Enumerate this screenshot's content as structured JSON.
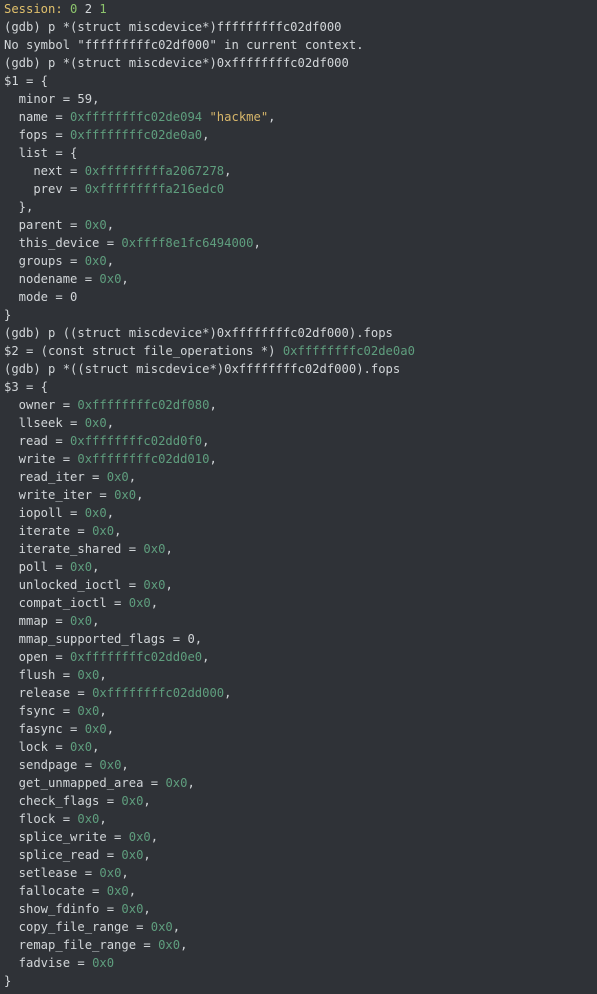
{
  "session_line": {
    "label": "Session:",
    "vals": [
      "0",
      "2",
      "1"
    ]
  },
  "lines": [
    {
      "k": "plain",
      "text": "(gdb) p *(struct miscdevice*)fffffffffc02df000"
    },
    {
      "k": "plain",
      "text": "No symbol \"fffffffffc02df000\" in current context."
    },
    {
      "k": "plain",
      "text": "(gdb) p *(struct miscdevice*)0xffffffffc02df000"
    },
    {
      "k": "plain",
      "text": "$1 = {"
    },
    {
      "k": "kv",
      "indent": "  ",
      "key": "minor",
      "sep": " = ",
      "val": "59",
      "cls": "num",
      "tail": ","
    },
    {
      "k": "kvq",
      "indent": "  ",
      "key": "name",
      "sep": " = ",
      "addr": "0xffffffffc02de094",
      "str": "\"hackme\"",
      "tail": ","
    },
    {
      "k": "kv",
      "indent": "  ",
      "key": "fops",
      "sep": " = ",
      "val": "0xffffffffc02de0a0",
      "cls": "addr",
      "tail": ","
    },
    {
      "k": "plain",
      "text": "  list = {"
    },
    {
      "k": "kv",
      "indent": "    ",
      "key": "next",
      "sep": " = ",
      "val": "0xfffffffffa2067278",
      "cls": "addr",
      "tail": ","
    },
    {
      "k": "kv",
      "indent": "    ",
      "key": "prev",
      "sep": " = ",
      "val": "0xfffffffffa216edc0",
      "cls": "addr",
      "tail": ""
    },
    {
      "k": "plain",
      "text": "  },"
    },
    {
      "k": "kv",
      "indent": "  ",
      "key": "parent",
      "sep": " = ",
      "val": "0x0",
      "cls": "addr",
      "tail": ","
    },
    {
      "k": "kv",
      "indent": "  ",
      "key": "this_device",
      "sep": " = ",
      "val": "0xffff8e1fc6494000",
      "cls": "addr",
      "tail": ","
    },
    {
      "k": "kv",
      "indent": "  ",
      "key": "groups",
      "sep": " = ",
      "val": "0x0",
      "cls": "addr",
      "tail": ","
    },
    {
      "k": "kv",
      "indent": "  ",
      "key": "nodename",
      "sep": " = ",
      "val": "0x0",
      "cls": "addr",
      "tail": ","
    },
    {
      "k": "kv",
      "indent": "  ",
      "key": "mode",
      "sep": " = ",
      "val": "0",
      "cls": "num",
      "tail": ""
    },
    {
      "k": "plain",
      "text": "}"
    },
    {
      "k": "plain",
      "text": "(gdb) p ((struct miscdevice*)0xffffffffc02df000).fops"
    },
    {
      "k": "resptr",
      "pre": "$2 = (const struct file_operations *) ",
      "addr": "0xffffffffc02de0a0"
    },
    {
      "k": "plain",
      "text": "(gdb) p *((struct miscdevice*)0xffffffffc02df000).fops"
    },
    {
      "k": "plain",
      "text": "$3 = {"
    },
    {
      "k": "kv",
      "indent": "  ",
      "key": "owner",
      "sep": " = ",
      "val": "0xffffffffc02df080",
      "cls": "addr",
      "tail": ","
    },
    {
      "k": "kv",
      "indent": "  ",
      "key": "llseek",
      "sep": " = ",
      "val": "0x0",
      "cls": "addr",
      "tail": ","
    },
    {
      "k": "kv",
      "indent": "  ",
      "key": "read",
      "sep": " = ",
      "val": "0xffffffffc02dd0f0",
      "cls": "addr",
      "tail": ","
    },
    {
      "k": "kv",
      "indent": "  ",
      "key": "write",
      "sep": " = ",
      "val": "0xffffffffc02dd010",
      "cls": "addr",
      "tail": ","
    },
    {
      "k": "kv",
      "indent": "  ",
      "key": "read_iter",
      "sep": " = ",
      "val": "0x0",
      "cls": "addr",
      "tail": ","
    },
    {
      "k": "kv",
      "indent": "  ",
      "key": "write_iter",
      "sep": " = ",
      "val": "0x0",
      "cls": "addr",
      "tail": ","
    },
    {
      "k": "kv",
      "indent": "  ",
      "key": "iopoll",
      "sep": " = ",
      "val": "0x0",
      "cls": "addr",
      "tail": ","
    },
    {
      "k": "kv",
      "indent": "  ",
      "key": "iterate",
      "sep": " = ",
      "val": "0x0",
      "cls": "addr",
      "tail": ","
    },
    {
      "k": "kv",
      "indent": "  ",
      "key": "iterate_shared",
      "sep": " = ",
      "val": "0x0",
      "cls": "addr",
      "tail": ","
    },
    {
      "k": "kv",
      "indent": "  ",
      "key": "poll",
      "sep": " = ",
      "val": "0x0",
      "cls": "addr",
      "tail": ","
    },
    {
      "k": "kv",
      "indent": "  ",
      "key": "unlocked_ioctl",
      "sep": " = ",
      "val": "0x0",
      "cls": "addr",
      "tail": ","
    },
    {
      "k": "kv",
      "indent": "  ",
      "key": "compat_ioctl",
      "sep": " = ",
      "val": "0x0",
      "cls": "addr",
      "tail": ","
    },
    {
      "k": "kv",
      "indent": "  ",
      "key": "mmap",
      "sep": " = ",
      "val": "0x0",
      "cls": "addr",
      "tail": ","
    },
    {
      "k": "kv",
      "indent": "  ",
      "key": "mmap_supported_flags",
      "sep": " = ",
      "val": "0",
      "cls": "num",
      "tail": ","
    },
    {
      "k": "kv",
      "indent": "  ",
      "key": "open",
      "sep": " = ",
      "val": "0xffffffffc02dd0e0",
      "cls": "addr",
      "tail": ","
    },
    {
      "k": "kv",
      "indent": "  ",
      "key": "flush",
      "sep": " = ",
      "val": "0x0",
      "cls": "addr",
      "tail": ","
    },
    {
      "k": "kv",
      "indent": "  ",
      "key": "release",
      "sep": " = ",
      "val": "0xffffffffc02dd000",
      "cls": "addr",
      "tail": ","
    },
    {
      "k": "kv",
      "indent": "  ",
      "key": "fsync",
      "sep": " = ",
      "val": "0x0",
      "cls": "addr",
      "tail": ","
    },
    {
      "k": "kv",
      "indent": "  ",
      "key": "fasync",
      "sep": " = ",
      "val": "0x0",
      "cls": "addr",
      "tail": ","
    },
    {
      "k": "kv",
      "indent": "  ",
      "key": "lock",
      "sep": " = ",
      "val": "0x0",
      "cls": "addr",
      "tail": ","
    },
    {
      "k": "kv",
      "indent": "  ",
      "key": "sendpage",
      "sep": " = ",
      "val": "0x0",
      "cls": "addr",
      "tail": ","
    },
    {
      "k": "kv",
      "indent": "  ",
      "key": "get_unmapped_area",
      "sep": " = ",
      "val": "0x0",
      "cls": "addr",
      "tail": ","
    },
    {
      "k": "kv",
      "indent": "  ",
      "key": "check_flags",
      "sep": " = ",
      "val": "0x0",
      "cls": "addr",
      "tail": ","
    },
    {
      "k": "kv",
      "indent": "  ",
      "key": "flock",
      "sep": " = ",
      "val": "0x0",
      "cls": "addr",
      "tail": ","
    },
    {
      "k": "kv",
      "indent": "  ",
      "key": "splice_write",
      "sep": " = ",
      "val": "0x0",
      "cls": "addr",
      "tail": ","
    },
    {
      "k": "kv",
      "indent": "  ",
      "key": "splice_read",
      "sep": " = ",
      "val": "0x0",
      "cls": "addr",
      "tail": ","
    },
    {
      "k": "kv",
      "indent": "  ",
      "key": "setlease",
      "sep": " = ",
      "val": "0x0",
      "cls": "addr",
      "tail": ","
    },
    {
      "k": "kv",
      "indent": "  ",
      "key": "fallocate",
      "sep": " = ",
      "val": "0x0",
      "cls": "addr",
      "tail": ","
    },
    {
      "k": "kv",
      "indent": "  ",
      "key": "show_fdinfo",
      "sep": " = ",
      "val": "0x0",
      "cls": "addr",
      "tail": ","
    },
    {
      "k": "kv",
      "indent": "  ",
      "key": "copy_file_range",
      "sep": " = ",
      "val": "0x0",
      "cls": "addr",
      "tail": ","
    },
    {
      "k": "kv",
      "indent": "  ",
      "key": "remap_file_range",
      "sep": " = ",
      "val": "0x0",
      "cls": "addr",
      "tail": ","
    },
    {
      "k": "kv",
      "indent": "  ",
      "key": "fadvise",
      "sep": " = ",
      "val": "0x0",
      "cls": "addr",
      "tail": ""
    },
    {
      "k": "plain",
      "text": "}"
    }
  ]
}
